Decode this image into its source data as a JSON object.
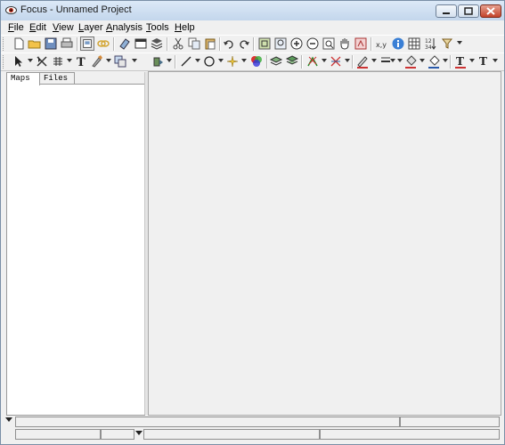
{
  "window": {
    "title": "Focus - Unnamed Project"
  },
  "menubar": {
    "items": [
      {
        "label": "File"
      },
      {
        "label": "Edit"
      },
      {
        "label": "View"
      },
      {
        "label": "Layer"
      },
      {
        "label": "Analysis"
      },
      {
        "label": "Tools"
      },
      {
        "label": "Help"
      }
    ]
  },
  "toolbar_row2": {
    "text_tool_glyph": "T",
    "font_glyph_1": "T",
    "font_glyph_2": "T"
  },
  "panel": {
    "tabs": [
      {
        "label": "Maps"
      },
      {
        "label": "Files"
      }
    ]
  },
  "colors": {
    "accent": "#3a6ea5",
    "close_button": "#c3432b"
  }
}
